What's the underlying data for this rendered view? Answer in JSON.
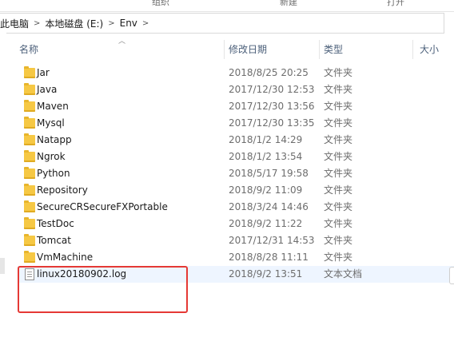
{
  "ribbon": {
    "labels": [
      "组织",
      "新建",
      "打开"
    ]
  },
  "address": {
    "segments": [
      "此电脑",
      "本地磁盘 (E:)",
      "Env"
    ]
  },
  "columns": {
    "name": "名称",
    "date": "修改日期",
    "type": "类型",
    "size": "大小"
  },
  "rows": [
    {
      "name": "Jar",
      "date": "2018/8/25 20:25",
      "type": "文件夹",
      "kind": "folder"
    },
    {
      "name": "Java",
      "date": "2017/12/30 12:53",
      "type": "文件夹",
      "kind": "folder"
    },
    {
      "name": "Maven",
      "date": "2017/12/30 13:56",
      "type": "文件夹",
      "kind": "folder"
    },
    {
      "name": "Mysql",
      "date": "2017/12/30 13:35",
      "type": "文件夹",
      "kind": "folder"
    },
    {
      "name": "Natapp",
      "date": "2018/1/2 14:29",
      "type": "文件夹",
      "kind": "folder"
    },
    {
      "name": "Ngrok",
      "date": "2018/1/2 13:54",
      "type": "文件夹",
      "kind": "folder"
    },
    {
      "name": "Python",
      "date": "2018/5/17 19:58",
      "type": "文件夹",
      "kind": "folder"
    },
    {
      "name": "Repository",
      "date": "2018/9/2 11:09",
      "type": "文件夹",
      "kind": "folder"
    },
    {
      "name": "SecureCRSecureFXPortable",
      "date": "2018/3/24 14:46",
      "type": "文件夹",
      "kind": "folder"
    },
    {
      "name": "TestDoc",
      "date": "2018/9/2 11:22",
      "type": "文件夹",
      "kind": "folder"
    },
    {
      "name": "Tomcat",
      "date": "2017/12/31 14:53",
      "type": "文件夹",
      "kind": "folder"
    },
    {
      "name": "VmMachine",
      "date": "2018/8/28 11:11",
      "type": "文件夹",
      "kind": "folder"
    },
    {
      "name": "linux20180902.log",
      "date": "2018/9/2 13:51",
      "type": "文本文档",
      "kind": "file"
    }
  ],
  "colors": {
    "header_text": "#4c607a",
    "selected_row": "#eef5ff",
    "highlight_box": "#e53935",
    "folder": "#f6c844"
  },
  "icons": {
    "folder": "folder-icon",
    "file": "text-file-icon",
    "separator": "chevron-right-icon",
    "sort": "sort-up-icon"
  }
}
